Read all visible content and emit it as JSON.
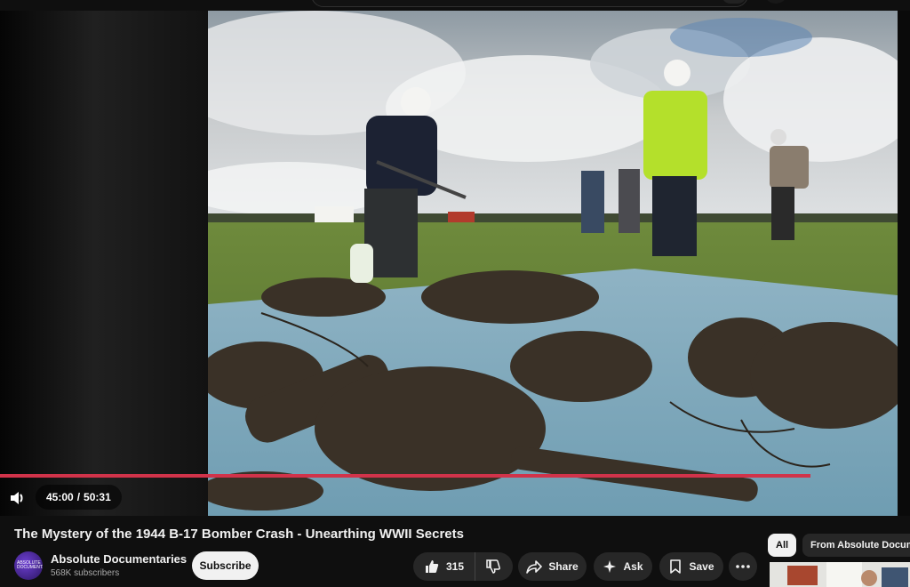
{
  "video": {
    "title": "The Mystery of the 1944 B-17 Bomber Crash - Unearthing WWII Secrets",
    "current_time": "45:00",
    "duration": "50:31",
    "time_separator": "/",
    "progress": 0.891,
    "progress_color": "#d1334a"
  },
  "channel": {
    "name": "Absolute Documentaries",
    "subscribers": "568K subscribers",
    "avatar_text": "ABSOLUTE DOCUMENTARIES"
  },
  "actions": {
    "subscribe_label": "Subscribe",
    "like_count": "315",
    "share_label": "Share",
    "ask_label": "Ask",
    "save_label": "Save"
  },
  "sidebar": {
    "chips": [
      "All",
      "From Absolute Docume"
    ]
  },
  "icons": {
    "volume": "volume-icon",
    "like": "thumbs-up-icon",
    "dislike": "thumbs-down-icon",
    "share": "share-arrow-icon",
    "ask": "sparkle-icon",
    "save": "bookmark-icon",
    "more": "more-horizontal-icon"
  }
}
